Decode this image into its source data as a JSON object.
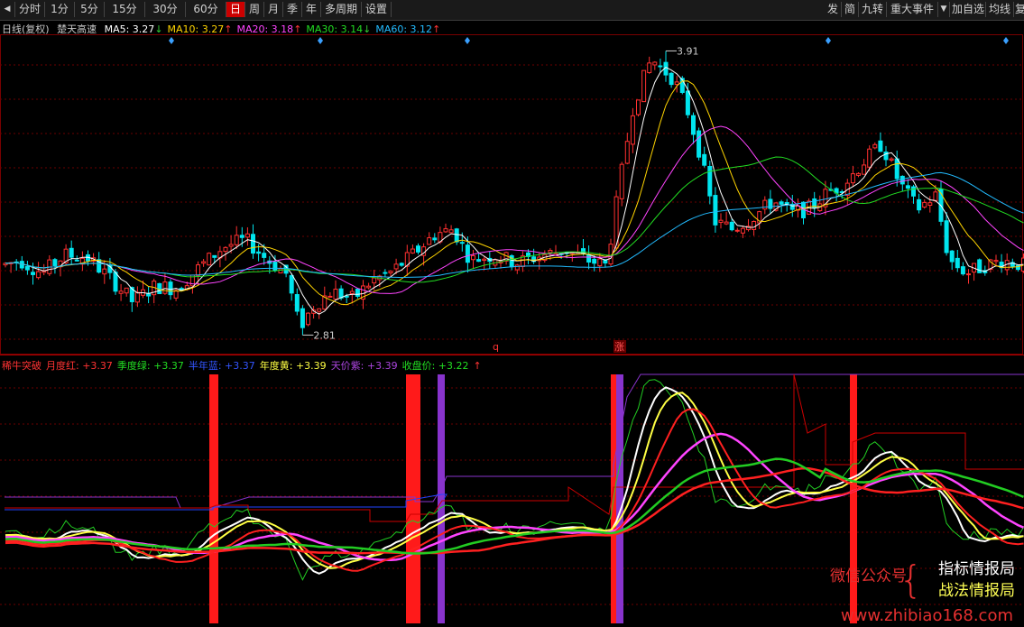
{
  "toolbar": {
    "left_items": [
      {
        "label": "分时"
      },
      {
        "label": "1分"
      },
      {
        "label": "5分"
      },
      {
        "label": "15分"
      },
      {
        "label": "30分"
      },
      {
        "label": "60分"
      },
      {
        "label": "日",
        "active": true
      },
      {
        "label": "周"
      },
      {
        "label": "月"
      },
      {
        "label": "季"
      },
      {
        "label": "年"
      },
      {
        "label": "多周期"
      },
      {
        "label": "设置"
      }
    ],
    "right_items": [
      {
        "label": "发"
      },
      {
        "label": "简"
      },
      {
        "label": "九转"
      },
      {
        "label": "重大事件"
      },
      {
        "label": "加自选"
      },
      {
        "label": "均线"
      },
      {
        "label": "复"
      }
    ]
  },
  "main_legend": {
    "period": "日线(复权)",
    "stock": "楚天高速",
    "ma": [
      {
        "label": "MA5: 3.27",
        "arrow": "↓",
        "color": "#ffffff"
      },
      {
        "label": "MA10: 3.27",
        "arrow": "↑",
        "color": "#ffd400"
      },
      {
        "label": "MA20: 3.18",
        "arrow": "↑",
        "color": "#ff44ff"
      },
      {
        "label": "MA30: 3.14",
        "arrow": "↓",
        "color": "#22dd22"
      },
      {
        "label": "MA60: 3.12",
        "arrow": "↑",
        "color": "#22bbff"
      }
    ]
  },
  "price_labels": {
    "high": "3.91",
    "low": "2.81",
    "marker_q": "q",
    "marker_zhang": "涨"
  },
  "indicator_legend": {
    "items": [
      {
        "label": "稀牛突破",
        "color": "#ff3333"
      },
      {
        "label": "月度红: +3.37",
        "color": "#ff3333"
      },
      {
        "label": "季度绿: +3.37",
        "color": "#22dd22"
      },
      {
        "label": "半年蓝: +3.37",
        "color": "#3355ff"
      },
      {
        "label": "年度黄: +3.39",
        "color": "#ffff44"
      },
      {
        "label": "天价紫: +3.39",
        "color": "#aa44dd"
      },
      {
        "label": "收盘价: +3.22",
        "color": "#22dd22"
      }
    ],
    "last_arrow": "↑"
  },
  "watermark": {
    "line1": "微信公众号",
    "brace": "{",
    "line2": "指标情报局",
    "line3": "战法情报局",
    "url": "www.zhibiao168.com"
  },
  "colors": {
    "up": "#ff3030",
    "down": "#00e5ee",
    "grid": "#6a0000",
    "ma5": "#ffffff",
    "ma10": "#ffd400",
    "ma20": "#ff44ff",
    "ma30": "#22dd22",
    "ma60": "#22bbff"
  }
}
